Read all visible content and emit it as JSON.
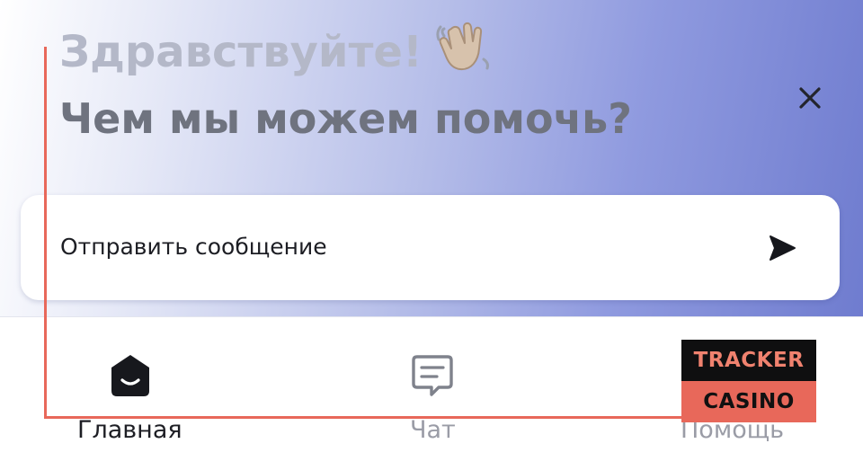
{
  "header": {
    "greeting": "Здравствуйте!",
    "question": "Чем мы можем помочь?",
    "wave_icon": "waving-hand-icon",
    "close_icon": "close-icon"
  },
  "message_card": {
    "label": "Отправить сообщение",
    "send_icon": "send-arrow-icon"
  },
  "tabs": [
    {
      "label": "Главная",
      "icon": "home-icon",
      "active": true
    },
    {
      "label": "Чат",
      "icon": "chat-icon",
      "active": false
    },
    {
      "label": "Помощь",
      "icon": "help-icon",
      "active": false
    }
  ],
  "watermark": {
    "line1": "TRACKER",
    "line2": "CASINO"
  },
  "colors": {
    "accent": "#6f7ccf",
    "overlay": "#e8685a",
    "active_text": "#1d1e24",
    "inactive_text": "#9a9ca6"
  }
}
